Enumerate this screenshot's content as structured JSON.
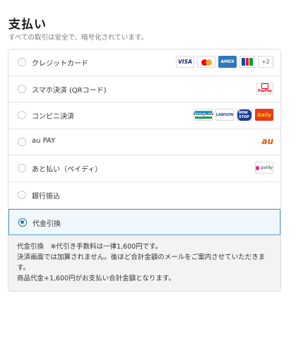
{
  "header": {
    "title": "支払い",
    "subtitle": "すべての取引は安全で、暗号化されています。"
  },
  "payment_methods": [
    {
      "label": "クレジットカード",
      "selected": false
    },
    {
      "label": "スマホ決済 (QRコード)",
      "selected": false
    },
    {
      "label": "コンビニ決済",
      "selected": false
    },
    {
      "label": "au PAY",
      "selected": false
    },
    {
      "label": "あと払い（ペイディ）",
      "selected": false
    },
    {
      "label": "銀行振込",
      "selected": false
    },
    {
      "label": "代金引換",
      "selected": true
    }
  ],
  "logos": {
    "visa": "VISA",
    "amex": "AMEX",
    "jcb": "JCB",
    "more_cards": "+2",
    "paypay": "PayPay",
    "famima": "FamilyMart",
    "lawson": "LAWSON",
    "ministop": "MINI STOP",
    "daily": "Daily",
    "au": "au",
    "paidy": "paidy"
  },
  "cod_note": {
    "line1": "代金引換　※代引き手数料は一律1,600円です。",
    "line2": "決済画面では加算されません。後ほど合計金額のメールをご案内させていただきま",
    "line3": "す。",
    "line4": "商品代金+1,600円がお支払い合計金額となります。"
  },
  "colors": {
    "selected_border": "#4a9fd0",
    "radio_accent": "#1a73b8",
    "selected_bg": "#f1f8fd"
  }
}
